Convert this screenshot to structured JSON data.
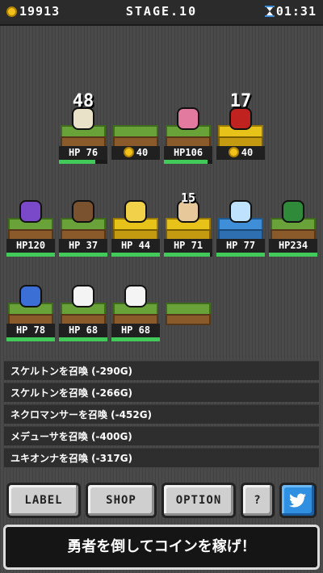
{
  "hud": {
    "coins": "19913",
    "stage": "STAGE.10",
    "time": "01:31"
  },
  "monsters": [
    {
      "row": 1,
      "col": 1,
      "hp": "HP 76",
      "hp_fill": 0.75,
      "float": "48",
      "color": "#e9e1c8",
      "platform": "grass"
    },
    {
      "row": 1,
      "col": 2,
      "hp": "40",
      "hp_fill": null,
      "float": "",
      "color": "",
      "platform": "grass",
      "cost": true
    },
    {
      "row": 1,
      "col": 3,
      "hp": "HP106",
      "hp_fill": 0.9,
      "float": "",
      "color": "#e27aa0",
      "platform": "grass"
    },
    {
      "row": 1,
      "col": 4,
      "hp": "40",
      "hp_fill": null,
      "float": "17",
      "color": "#c0221f",
      "platform": "gold",
      "cost": true
    },
    {
      "row": 2,
      "col": 0,
      "hp": "HP120",
      "hp_fill": 1.0,
      "float": "",
      "color": "#7a49c9",
      "platform": "grass"
    },
    {
      "row": 2,
      "col": 1,
      "hp": "HP 37",
      "hp_fill": 1.0,
      "float": "",
      "color": "#7a5230",
      "platform": "grass"
    },
    {
      "row": 2,
      "col": 2,
      "hp": "HP 44",
      "hp_fill": 1.0,
      "float": "",
      "color": "#f2d14a",
      "platform": "gold"
    },
    {
      "row": 2,
      "col": 3,
      "hp": "HP 71",
      "hp_fill": 0.95,
      "float": "15",
      "color": "#e6c89a",
      "platform": "gold"
    },
    {
      "row": 2,
      "col": 4,
      "hp": "HP 77",
      "hp_fill": 1.0,
      "float": "",
      "color": "#bfe3ff",
      "platform": "blue"
    },
    {
      "row": 2,
      "col": 5,
      "hp": "HP234",
      "hp_fill": 1.0,
      "float": "",
      "color": "#2f8a3a",
      "platform": "grass"
    },
    {
      "row": 3,
      "col": 0,
      "hp": "HP 78",
      "hp_fill": 1.0,
      "float": "",
      "color": "#3b6fd6",
      "platform": "grass"
    },
    {
      "row": 3,
      "col": 1,
      "hp": "HP 68",
      "hp_fill": 1.0,
      "float": "",
      "color": "#f4f4f4",
      "platform": "grass"
    },
    {
      "row": 3,
      "col": 2,
      "hp": "HP 68",
      "hp_fill": 1.0,
      "float": "",
      "color": "#f4f4f4",
      "platform": "grass"
    },
    {
      "row": 3,
      "col": 3,
      "hp": "",
      "hp_fill": null,
      "float": "",
      "color": "",
      "platform": "grass"
    }
  ],
  "log": [
    "スケルトンを召喚 (-290G)",
    "スケルトンを召喚 (-266G)",
    "ネクロマンサーを召喚 (-452G)",
    "メデューサを召喚 (-400G)",
    "ユキオンナを召喚 (-317G)"
  ],
  "buttons": {
    "label": "LABEL",
    "shop": "SHOP",
    "option": "OPTION",
    "help": "?"
  },
  "banner": "勇者を倒してコインを稼げ！"
}
